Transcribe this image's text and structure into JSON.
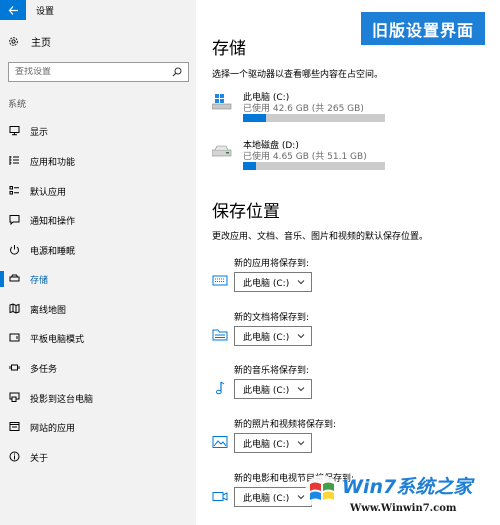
{
  "window": {
    "title": "设置"
  },
  "sidebar": {
    "home_label": "主页",
    "search_placeholder": "查找设置",
    "section_label": "系统",
    "items": [
      {
        "label": "显示",
        "icon": "monitor-icon",
        "active": false
      },
      {
        "label": "应用和功能",
        "icon": "list-icon",
        "active": false
      },
      {
        "label": "默认应用",
        "icon": "default-apps-icon",
        "active": false
      },
      {
        "label": "通知和操作",
        "icon": "notification-icon",
        "active": false
      },
      {
        "label": "电源和睡眠",
        "icon": "power-icon",
        "active": false
      },
      {
        "label": "存储",
        "icon": "storage-icon",
        "active": true
      },
      {
        "label": "离线地图",
        "icon": "map-icon",
        "active": false
      },
      {
        "label": "平板电脑模式",
        "icon": "tablet-icon",
        "active": false
      },
      {
        "label": "多任务",
        "icon": "multitask-icon",
        "active": false
      },
      {
        "label": "投影到这台电脑",
        "icon": "project-icon",
        "active": false
      },
      {
        "label": "网站的应用",
        "icon": "web-apps-icon",
        "active": false
      },
      {
        "label": "关于",
        "icon": "info-icon",
        "active": false
      }
    ]
  },
  "main": {
    "badge": "旧版设置界面",
    "storage": {
      "title": "存储",
      "description": "选择一个驱动器以查看哪些内容在占空间。",
      "drives": [
        {
          "name": "此电脑 (C:)",
          "usage": "已使用 42.6 GB (共 265 GB)",
          "used_fraction": 0.161,
          "icon": "system-drive-icon"
        },
        {
          "name": "本地磁盘 (D:)",
          "usage": "已使用 4.65 GB (共 51.1 GB)",
          "used_fraction": 0.091,
          "icon": "local-disk-icon"
        }
      ]
    },
    "save_locations": {
      "title": "保存位置",
      "description": "更改应用、文档、音乐、图片和视频的默认保存位置。",
      "rows": [
        {
          "label": "新的应用将保存到:",
          "value": "此电脑 (C:)",
          "icon": "app-icon"
        },
        {
          "label": "新的文档将保存到:",
          "value": "此电脑 (C:)",
          "icon": "folder-icon"
        },
        {
          "label": "新的音乐将保存到:",
          "value": "此电脑 (C:)",
          "icon": "music-note-icon"
        },
        {
          "label": "新的照片和视频将保存到:",
          "value": "此电脑 (C:)",
          "icon": "picture-icon"
        },
        {
          "label": "新的电影和电视节目将保存到:",
          "value": "此电脑 (C:)",
          "icon": "video-camera-icon"
        }
      ]
    }
  },
  "watermark": {
    "brand": "Win7系统之家",
    "url": "Www.Winwin7.com"
  },
  "colors": {
    "accent": "#0078d7",
    "sidebar_bg": "#f2f2f2",
    "bar_track": "#cccccc",
    "badge_bg": "#1e7fd6"
  }
}
